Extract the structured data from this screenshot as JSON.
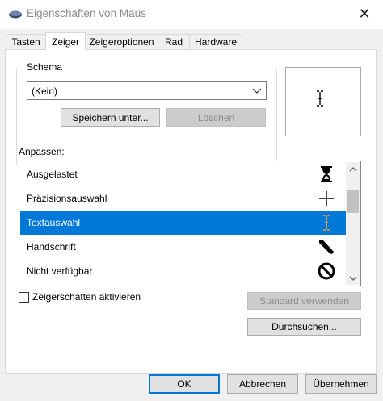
{
  "window": {
    "title": "Eigenschaften von Maus",
    "close_glyph": "✕"
  },
  "tabs": [
    {
      "label": "Tasten"
    },
    {
      "label": "Zeiger",
      "active": true
    },
    {
      "label": "Zeigeroptionen"
    },
    {
      "label": "Rad"
    },
    {
      "label": "Hardware"
    }
  ],
  "schema": {
    "group_label": "Schema",
    "selected_value": "(Kein)",
    "save_button": "Speichern unter...",
    "delete_button": "Löschen"
  },
  "customize": {
    "label": "Anpassen:",
    "rows": [
      {
        "label": "Ausgelastet",
        "icon": "hourglass-icon"
      },
      {
        "label": "Präzisionsauswahl",
        "icon": "crosshair-icon"
      },
      {
        "label": "Textauswahl",
        "icon": "ibeam-icon",
        "selected": true
      },
      {
        "label": "Handschrift",
        "icon": "pen-icon"
      },
      {
        "label": "Nicht verfügbar",
        "icon": "unavailable-icon"
      }
    ]
  },
  "options": {
    "shadow_checkbox_label": "Zeigerschatten aktivieren",
    "shadow_checked": false,
    "default_button": "Standard verwenden",
    "browse_button": "Durchsuchen..."
  },
  "footer": {
    "ok": "OK",
    "cancel": "Abbrechen",
    "apply": "Übernehmen"
  },
  "colors": {
    "selection": "#0078d7",
    "ibeam_selected": "#f0a030"
  }
}
